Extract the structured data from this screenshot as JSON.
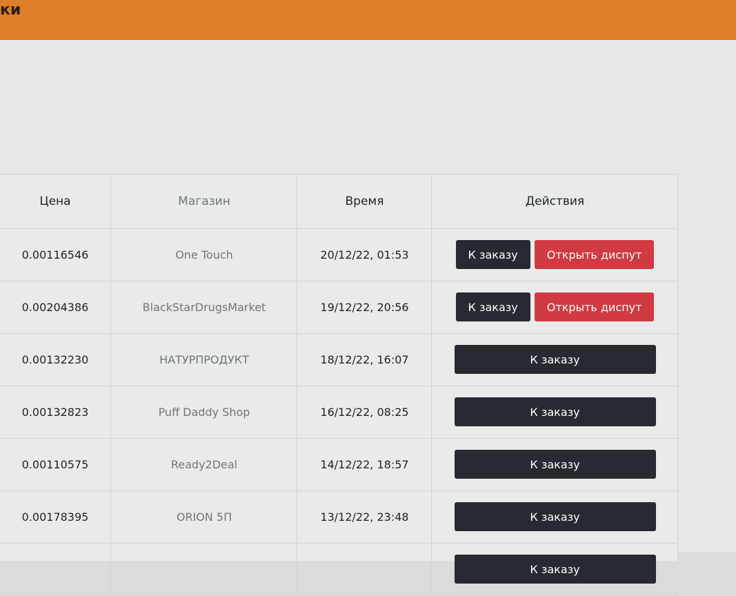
{
  "header": {
    "title_fragment": "ки"
  },
  "table": {
    "columns": [
      "Цена",
      "Магазин",
      "Время",
      "Действия"
    ],
    "rows": [
      {
        "price": "0.00116546",
        "shop": "One Touch",
        "time": "20/12/22, 01:53",
        "actions": [
          "К заказу",
          "Открыть диспут"
        ]
      },
      {
        "price": "0.00204386",
        "shop": "BlackStarDrugsMarket",
        "time": "19/12/22, 20:56",
        "actions": [
          "К заказу",
          "Открыть диспут"
        ]
      },
      {
        "price": "0.00132230",
        "shop": "НАТУРПРОДУКТ",
        "time": "18/12/22, 16:07",
        "actions": [
          "К заказу"
        ]
      },
      {
        "price": "0.00132823",
        "shop": "Puff Daddy Shop",
        "time": "16/12/22, 08:25",
        "actions": [
          "К заказу"
        ]
      },
      {
        "price": "0.00110575",
        "shop": "Ready2Deal",
        "time": "14/12/22, 18:57",
        "actions": [
          "К заказу"
        ]
      },
      {
        "price": "0.00178395",
        "shop": "ORION 5П",
        "time": "13/12/22, 23:48",
        "actions": [
          "К заказу"
        ]
      },
      {
        "price": "",
        "shop": "",
        "time": "",
        "actions": [
          "К заказу"
        ]
      }
    ]
  },
  "colors": {
    "topbar": "#e07f2a",
    "button_dark": "#262a31",
    "button_red": "#d23a41"
  }
}
